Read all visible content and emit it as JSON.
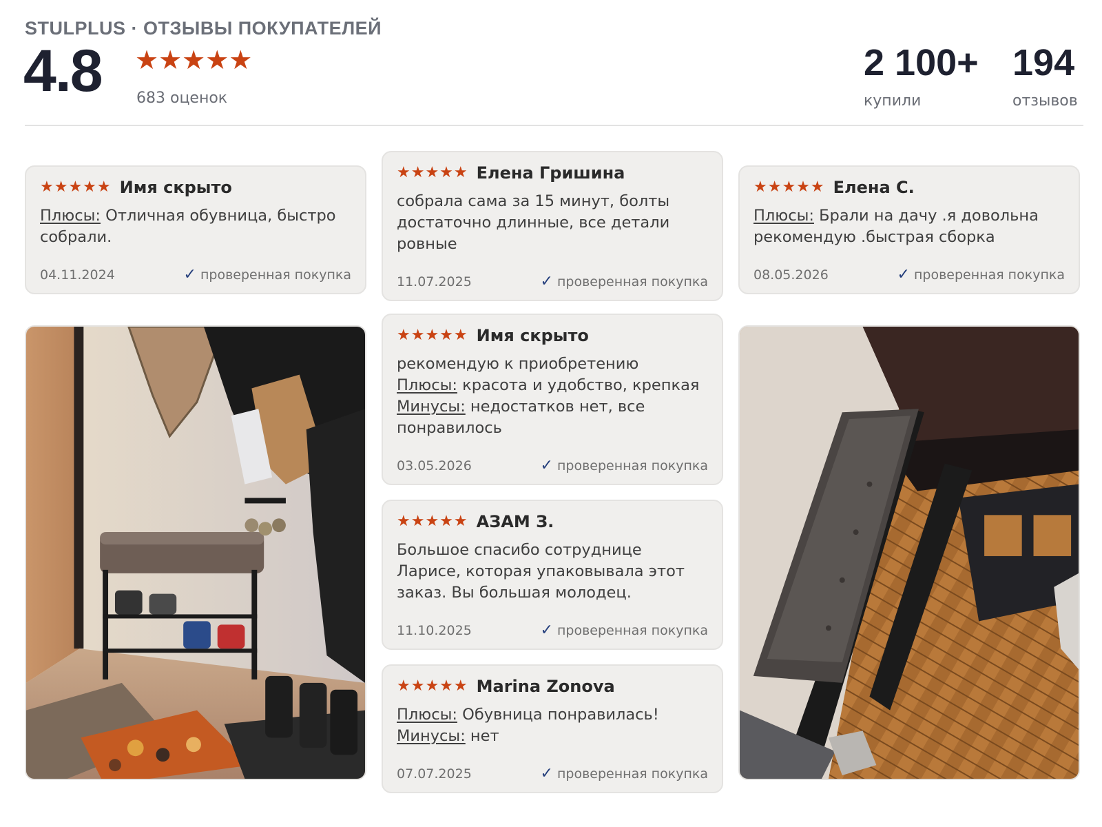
{
  "header": {
    "brand": "STULPLUS · ОТЗЫВЫ ПОКУПАТЕЛЕЙ",
    "rating": "4.8",
    "stars": "★★★★★",
    "rating_count": "683 оценок",
    "bought_value": "2 100+",
    "bought_label": "купили",
    "reviews_value": "194",
    "reviews_label": "отзывов"
  },
  "colors": {
    "accent_star": "#c94313",
    "check": "#253f7c",
    "card_bg": "#f0efed"
  },
  "reviews": [
    {
      "stars": "★★★★★",
      "author": "Имя скрыто",
      "lines": [
        {
          "k": "Плюсы:",
          "t": " Отличная обувница, быстро собрали."
        }
      ],
      "date": "04.11.2024",
      "verified": "проверенная покупка"
    },
    {
      "stars": "★★★★★",
      "author": "Елена Гришина",
      "lines": [
        {
          "k": "",
          "t": "собрала сама за 15 минут, болты достаточно длинные, все детали ровные"
        }
      ],
      "date": "11.07.2025",
      "verified": "проверенная покупка"
    },
    {
      "stars": "★★★★★",
      "author": "Елена С.",
      "lines": [
        {
          "k": "Плюсы:",
          "t": " Брали на дачу .я довольна рекомендую .быстрая сборка"
        }
      ],
      "date": "08.05.2026",
      "verified": "проверенная покупка"
    },
    {
      "stars": "★★★★★",
      "author": "Имя скрыто",
      "lines": [
        {
          "k": "",
          "t": "рекомендую к приобретению"
        },
        {
          "k": "Плюсы:",
          "t": " красота и удобство, крепкая"
        },
        {
          "k": "Минусы:",
          "t": " недостатков нет, все понравилось"
        }
      ],
      "date": "03.05.2026",
      "verified": "проверенная покупка"
    },
    {
      "stars": "★★★★★",
      "author": "АЗАМ З.",
      "lines": [
        {
          "k": "",
          "t": "Большое спасибо сотруднице Ларисе, которая упаковывала этот заказ. Вы большая молодец."
        }
      ],
      "date": "11.10.2025",
      "verified": "проверенная покупка"
    },
    {
      "stars": "★★★★★",
      "author": "Marina Zonova",
      "lines": [
        {
          "k": "Плюсы:",
          "t": " Обувница понравилась!"
        },
        {
          "k": "Минусы:",
          "t": " нет"
        }
      ],
      "date": "07.07.2025",
      "verified": "проверенная покупка"
    }
  ],
  "check_glyph": "✓"
}
